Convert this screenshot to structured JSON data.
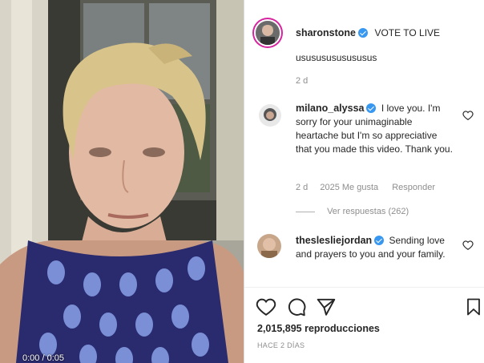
{
  "post": {
    "author": "sharonstone",
    "caption_tail": "VOTE TO LIVE",
    "caption": "usususususususus",
    "time": "2 d"
  },
  "comments": [
    {
      "user": "milano_alyssa",
      "text": "I love you. I'm sorry for your unimaginable heartache but I'm so appreciative that you made this video. Thank you.",
      "time": "2 d",
      "likes": "2025 Me gusta",
      "reply": "Responder",
      "view_replies": "Ver respuestas (262)"
    },
    {
      "user": "theslesliejordan",
      "text": "Sending love and prayers to you and your family."
    }
  ],
  "stats": {
    "views": "2,015,895 reproducciones",
    "posted": "HACE 2 DÍAS"
  },
  "video": {
    "timecode": "0:00 / 0:05"
  },
  "colors": {
    "verified": "#3897f0",
    "text": "#262626",
    "muted": "#8e8e8e",
    "dress": "#2a2a6e",
    "dots": "#7a8fd6"
  },
  "icons": [
    "heart-icon",
    "comment-icon",
    "share-icon",
    "bookmark-icon",
    "like-comment-icon"
  ]
}
